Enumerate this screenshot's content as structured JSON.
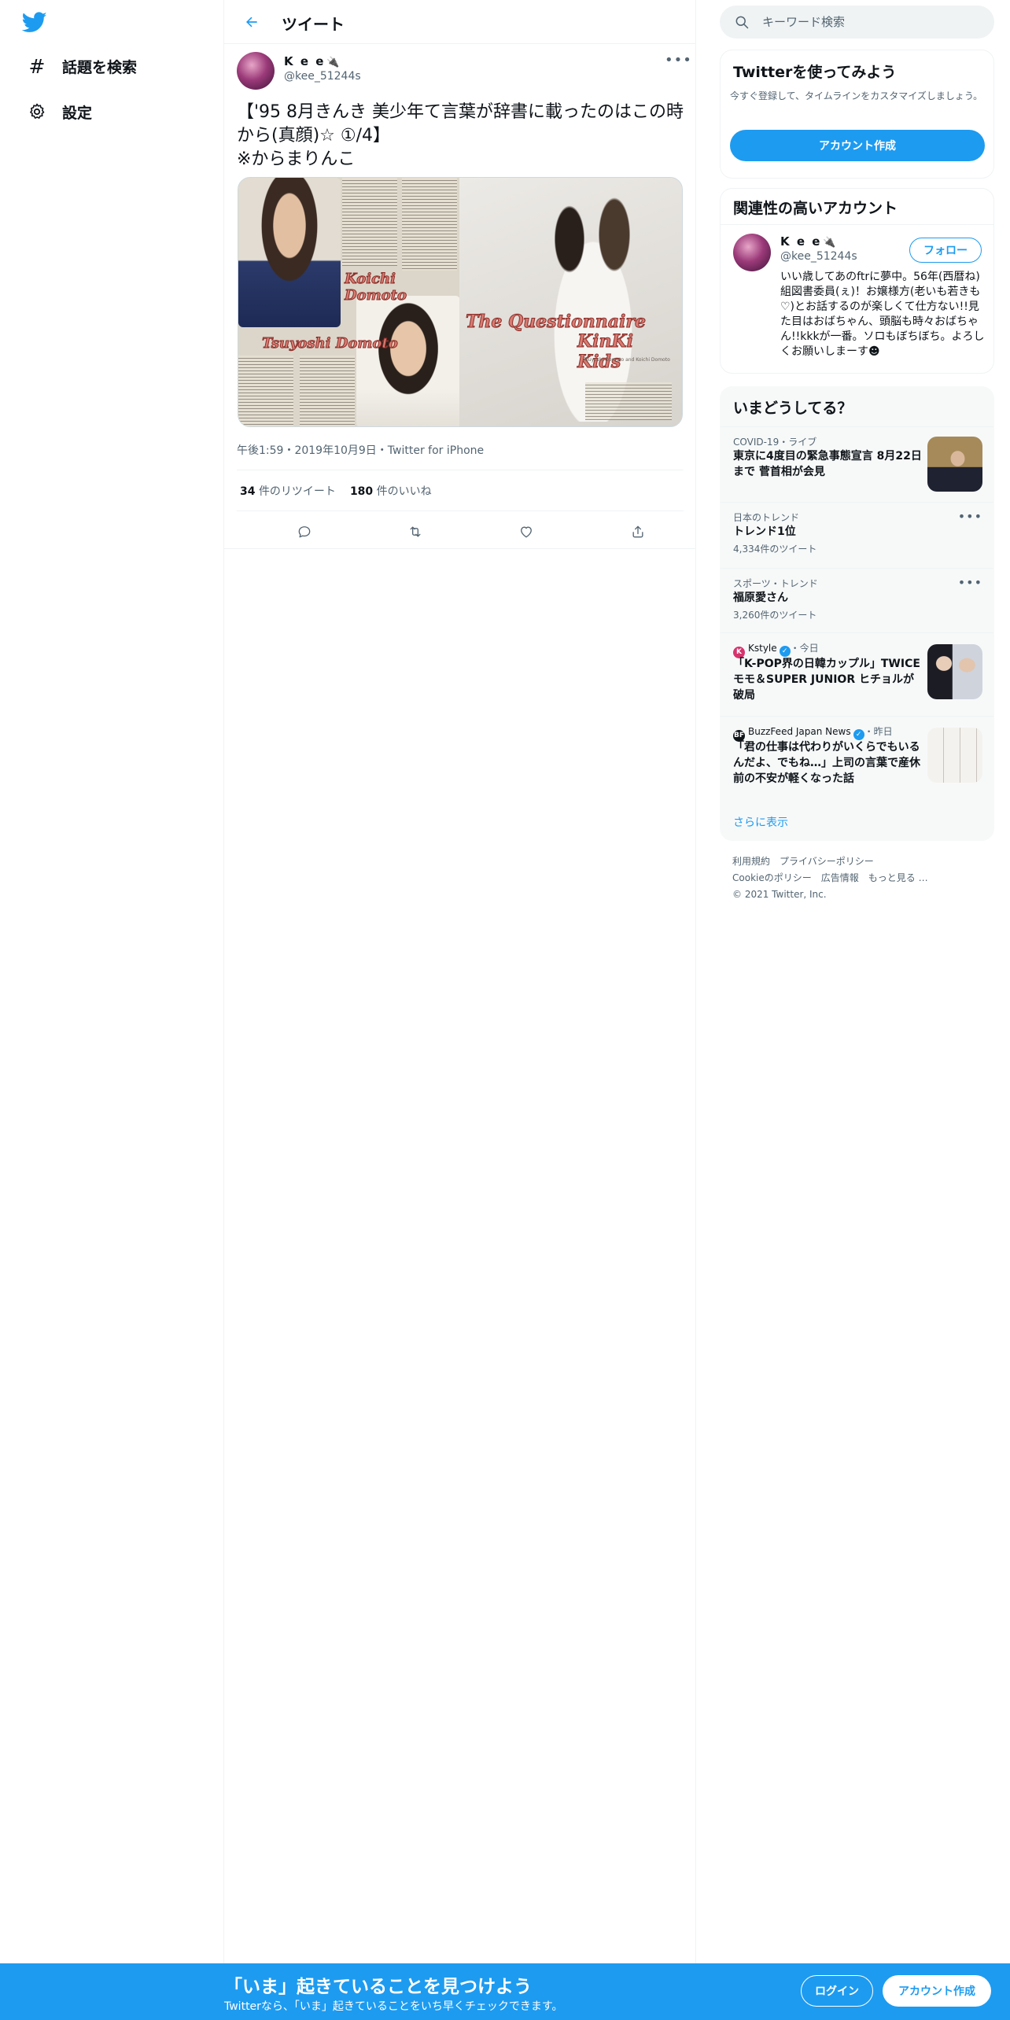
{
  "nav": {
    "items": [
      {
        "icon": "hash-icon",
        "label": "話題を検索"
      },
      {
        "icon": "gear-icon",
        "label": "設定"
      }
    ]
  },
  "header": {
    "title": "ツイート"
  },
  "tweet": {
    "author_name": "K e e",
    "author_emoji": "🔌",
    "author_handle": "@kee_51244s",
    "text": "【'95 8月きんき 美少年て言葉が辞書に載ったのはこの時から(真顔)☆ ①/4】\n※からまりんこ",
    "media_captions": {
      "left_name_1": "Koichi Domoto",
      "left_name_2": "Tsuyoshi Domoto",
      "right_title_1": "The Questionnaire",
      "right_title_2": "KinKi Kids",
      "right_credit": "Tsuyoshi Domoto and Koichi Domoto"
    },
    "meta": "午後1:59・2019年10月9日・Twitter for iPhone",
    "retweets": "34",
    "retweets_label": "件のリツイート",
    "likes": "180",
    "likes_label": "件のいいね",
    "actions": [
      "reply-icon",
      "retweet-icon",
      "like-icon",
      "share-icon"
    ]
  },
  "search": {
    "placeholder": "キーワード検索"
  },
  "try_twitter": {
    "title": "Twitterを使ってみよう",
    "subtitle": "今すぐ登録して、タイムラインをカスタマイズしましょう。",
    "button": "アカウント作成"
  },
  "related": {
    "title": "関連性の高いアカウント",
    "name": "K e e",
    "emoji": "🔌",
    "handle": "@kee_51244s",
    "follow": "フォロー",
    "bio": "いい歳してあのftrに夢中。56年(西暦ね)組図書委員(ぇ)！お嬢様方(老いも若きも♡)とお話するのが楽しくて仕方ない!!見た目はおばちゃん、頭脳も時々おばちゃん!!kkkが一番。ソロもぼちぼち。よろしくお願いしまーす☻"
  },
  "trends": {
    "title": "いまどうしてる？",
    "items": [
      {
        "context": "COVID-19・ライブ",
        "headline": "東京に4度目の緊急事態宣言 8月22日まで 菅首相が会見",
        "count": ""
      },
      {
        "context": "日本のトレンド",
        "headline": "トレンド1位",
        "count": "4,334件のツイート"
      },
      {
        "context": "スポーツ・トレンド",
        "headline": "福原愛さん",
        "count": "3,260件のツイート"
      },
      {
        "source": "Kstyle",
        "when": "・今日",
        "headline": "「K-POP界の日韓カップル」TWICE モモ＆SUPER JUNIOR ヒチョルが破局"
      },
      {
        "source": "BuzzFeed Japan News",
        "when": "・昨日",
        "headline": "「君の仕事は代わりがいくらでもいるんだよ、でもね…」上司の言葉で産休前の不安が軽くなった話"
      }
    ],
    "show_more": "さらに表示"
  },
  "footer": {
    "links": [
      "利用規約",
      "プライバシーポリシー",
      "Cookieのポリシー",
      "広告情報",
      "もっと見る …"
    ],
    "copyright": "© 2021 Twitter, Inc."
  },
  "bottom_bar": {
    "title": "「いま」起きていることを見つけよう",
    "subtitle": "Twitterなら、「いま」起きていることをいち早くチェックできます。",
    "login": "ログイン",
    "signup": "アカウント作成"
  },
  "colors": {
    "accent": "#1d9bf0",
    "text": "#0f1419",
    "secondary": "#536471"
  }
}
